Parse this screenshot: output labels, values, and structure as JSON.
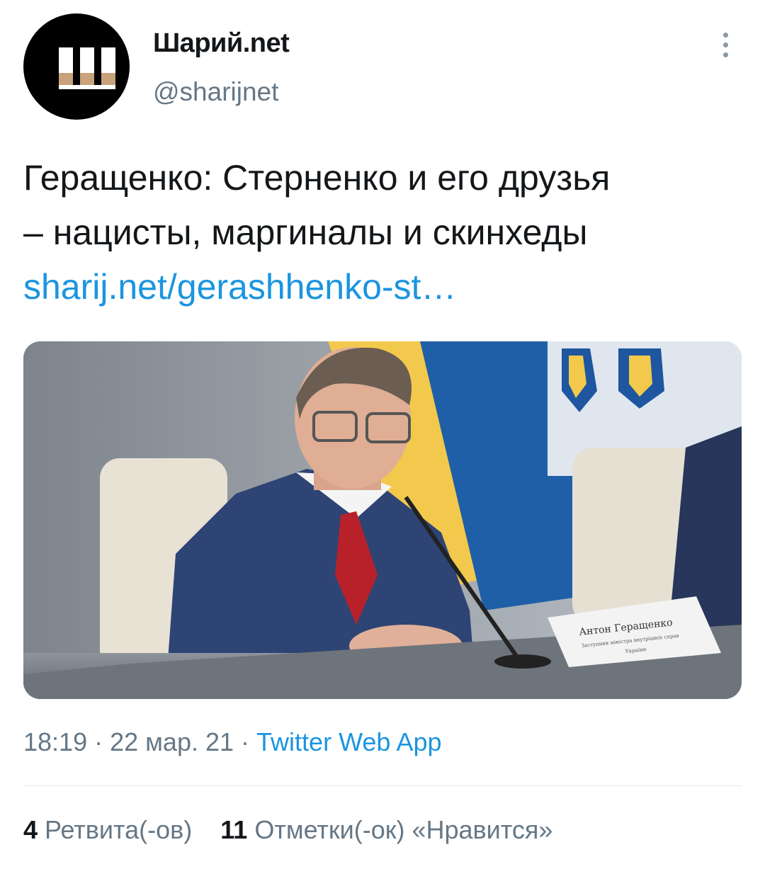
{
  "account": {
    "display_name": "Шарий.net",
    "handle": "@sharijnet",
    "avatar_icon": "sharij-logo-icon"
  },
  "tweet": {
    "text_line1": "Геращенко: Стерненко и его друзья",
    "text_line2": "– нацисты, маргиналы и скинхеды",
    "link": "sharij.net/gerashhenko-st…"
  },
  "media": {
    "alt": "photo",
    "nameplate_line1": "Антон Геращенко",
    "nameplate_line2": "Заступник міністра внутрішніх справ",
    "nameplate_line3": "України"
  },
  "meta": {
    "time": "18:19",
    "separator": "·",
    "date": "22 мар. 21",
    "source": "Twitter Web App"
  },
  "stats": {
    "retweets_count": "4",
    "retweets_label": "Ретвита(-ов)",
    "likes_count": "11",
    "likes_label": "Отметки(-ок) «Нравится»"
  },
  "colors": {
    "link": "#1b95e0",
    "secondary_text": "#657786",
    "primary_text": "#14171a",
    "divider": "#e1e8ed"
  }
}
